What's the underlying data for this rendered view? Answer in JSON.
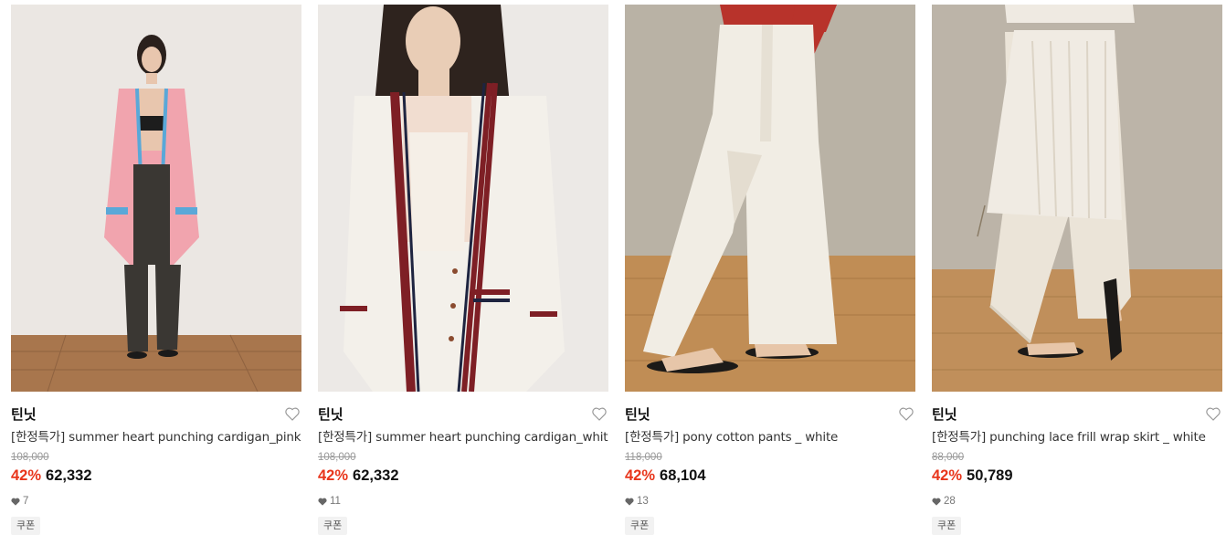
{
  "products": [
    {
      "image_alt": "model in pink punching cardigan",
      "brand": "틴닛",
      "title": "[한정특가] summer heart punching cardigan_pink",
      "original_price": "108,000",
      "discount": "42%",
      "price": "62,332",
      "likes": "7",
      "badge": "쿠폰",
      "colors": {
        "bg": "#ebe7e3",
        "floor": "#a8764d",
        "garment": "#f1a4ae"
      }
    },
    {
      "image_alt": "model in white punching cardigan",
      "brand": "틴닛",
      "title": "[한정특가] summer heart punching cardigan_white",
      "original_price": "108,000",
      "discount": "42%",
      "price": "62,332",
      "likes": "11",
      "badge": "쿠폰",
      "colors": {
        "bg": "#ece9e6",
        "garment": "#f3f0ea",
        "stripe": "#7e1f25"
      }
    },
    {
      "image_alt": "white cotton pants on wooden floor",
      "brand": "틴닛",
      "title": "[한정특가] pony cotton pants _ white",
      "original_price": "118,000",
      "discount": "42%",
      "price": "68,104",
      "likes": "13",
      "badge": "쿠폰",
      "colors": {
        "bg": "#b9b2a5",
        "floor": "#c08d55",
        "garment": "#f1ede4"
      }
    },
    {
      "image_alt": "lace frill wrap skirt over white pants",
      "brand": "틴닛",
      "title": "[한정특가] punching lace frill wrap skirt _ white",
      "original_price": "88,000",
      "discount": "42%",
      "price": "50,789",
      "likes": "28",
      "badge": "쿠폰",
      "colors": {
        "bg": "#bcb4a8",
        "floor": "#c08f5b",
        "garment": "#f0ebe3"
      }
    }
  ],
  "icons": {
    "wishlist": "heart-outline-icon",
    "likes": "heart-filled-icon"
  },
  "accent": "#e8351b"
}
